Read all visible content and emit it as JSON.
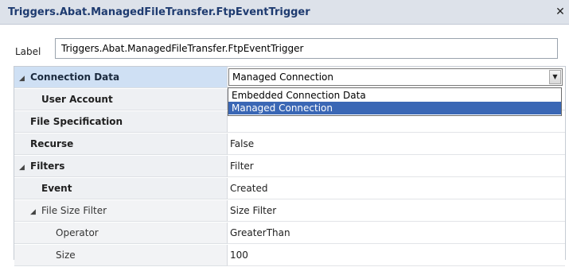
{
  "window": {
    "title": "Triggers.Abat.ManagedFileTransfer.FtpEventTrigger",
    "close_glyph": "✕"
  },
  "label_field": {
    "label": "Label",
    "value": "Triggers.Abat.ManagedFileTransfer.FtpEventTrigger"
  },
  "grid": {
    "rows": [
      {
        "name": "Connection Data",
        "value": "Managed Connection"
      },
      {
        "name": "User Account",
        "value": ""
      },
      {
        "name": "File Specification",
        "value": ""
      },
      {
        "name": "Recurse",
        "value": "False"
      },
      {
        "name": "Filters",
        "value": "Filter"
      },
      {
        "name": "Event",
        "value": "Created"
      },
      {
        "name": "File Size Filter",
        "value": "Size Filter"
      },
      {
        "name": "Operator",
        "value": "GreaterThan"
      },
      {
        "name": "Size",
        "value": "100"
      }
    ]
  },
  "dropdown": {
    "options": [
      "Embedded Connection Data",
      "Managed Connection"
    ],
    "selected": "Managed Connection"
  },
  "icons": {
    "expand": "◢",
    "combo_arrow": "▼"
  }
}
